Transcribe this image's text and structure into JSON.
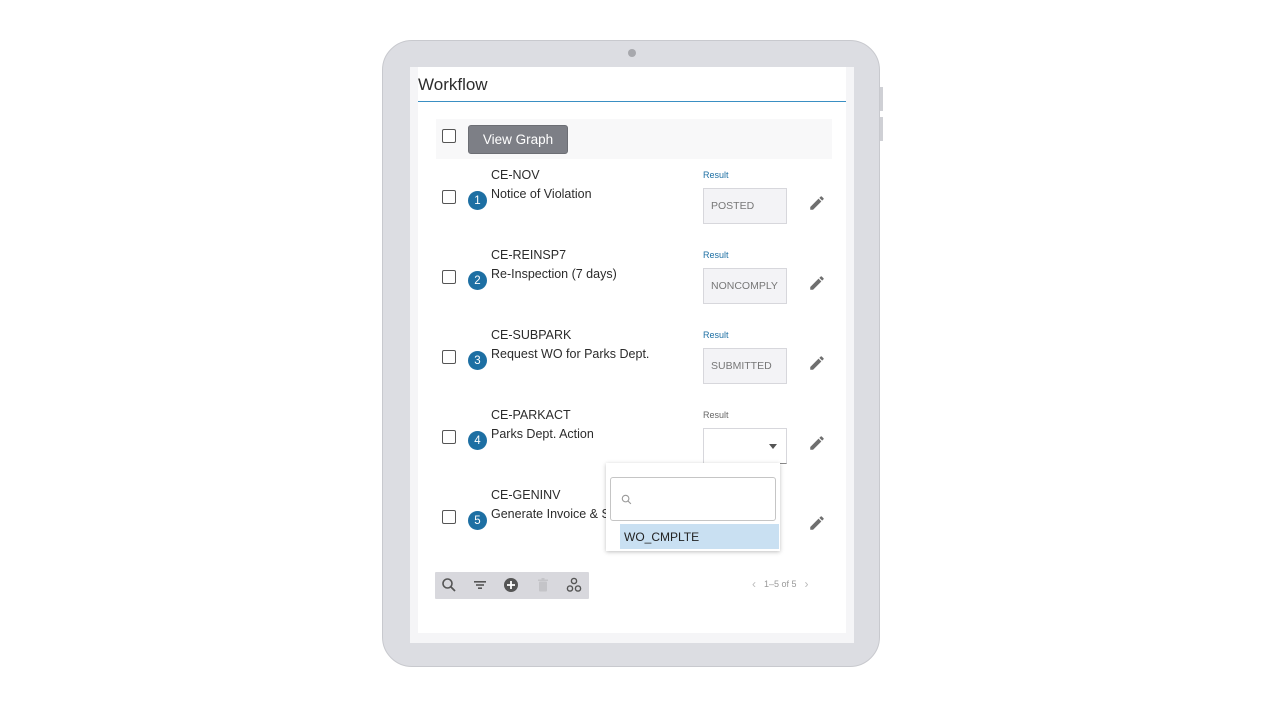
{
  "workflow": {
    "title": "Workflow",
    "view_graph_label": "View Graph",
    "result_label": "Result",
    "steps": [
      {
        "number": "1",
        "code": "CE-NOV",
        "description": "Notice of Violation",
        "result": "POSTED"
      },
      {
        "number": "2",
        "code": "CE-REINSP7",
        "description": "Re-Inspection (7 days)",
        "result": "NONCOMPLY"
      },
      {
        "number": "3",
        "code": "CE-SUBPARK",
        "description": "Request WO for Parks Dept.",
        "result": "SUBMITTED"
      },
      {
        "number": "4",
        "code": "CE-PARKACT",
        "description": "Parks Dept. Action",
        "result": ""
      },
      {
        "number": "5",
        "code": "CE-GENINV",
        "description": "Generate Invoice & S",
        "result": ""
      }
    ]
  },
  "dropdown": {
    "search_placeholder": "",
    "options": [
      "WO_CMPLTE"
    ]
  },
  "toolbar": {
    "icons": [
      "search-icon",
      "filter-icon",
      "add-circle-icon",
      "trash-icon",
      "workflow-nodes-icon"
    ]
  },
  "pagination": {
    "text": "1–5 of 5",
    "prev": "‹",
    "next": "›"
  },
  "colors": {
    "accent": "#1d6fa3",
    "button": "#7d7f86",
    "highlight": "#c9e0f2"
  }
}
